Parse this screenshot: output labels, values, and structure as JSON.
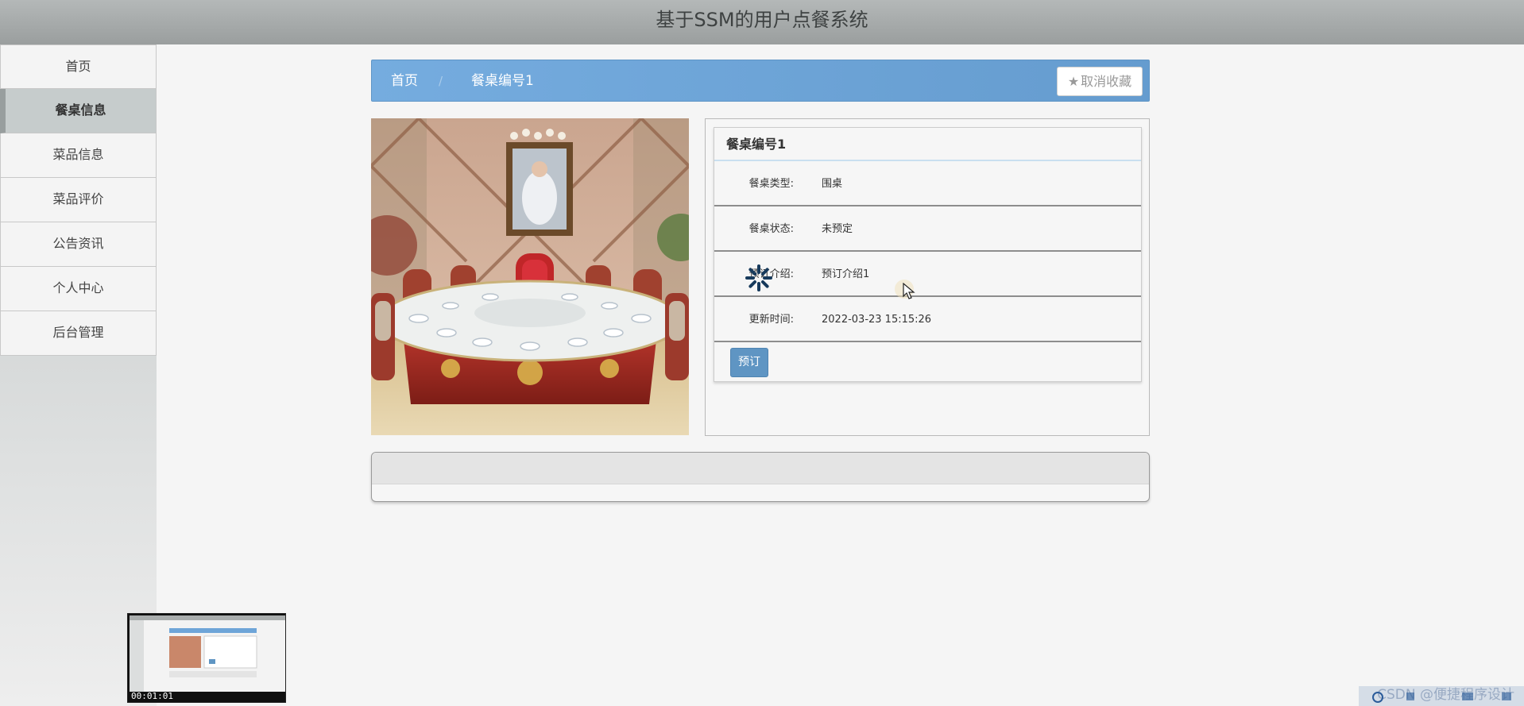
{
  "header": {
    "title": "基于SSM的用户点餐系统"
  },
  "sidebar": {
    "items": [
      {
        "label": "首页"
      },
      {
        "label": "餐桌信息"
      },
      {
        "label": "菜品信息"
      },
      {
        "label": "菜品评价"
      },
      {
        "label": "公告资讯"
      },
      {
        "label": "个人中心"
      },
      {
        "label": "后台管理"
      }
    ],
    "active_index": 1
  },
  "breadcrumb": {
    "home": "首页",
    "separator": "/",
    "current": "餐桌编号1",
    "favorite_label": "取消收藏",
    "favorite_icon": "star-icon"
  },
  "detail": {
    "title": "餐桌编号1",
    "fields": [
      {
        "label": "餐桌类型:",
        "value": "围桌"
      },
      {
        "label": "餐桌状态:",
        "value": "未预定"
      },
      {
        "label": "预订介绍:",
        "value": "预订介绍1"
      },
      {
        "label": "更新时间:",
        "value": "2022-03-23 15:15:26"
      }
    ],
    "book_label": "预订"
  },
  "overlay": {
    "video_time": "00:01:01",
    "watermark": "CSDN @便捷程序设计"
  },
  "colors": {
    "header_bg": "#a7abab",
    "breadcrumb_bg": "#6ea5d8",
    "book_button": "#5f95c3",
    "active_sidebar": "#c6cccc"
  }
}
